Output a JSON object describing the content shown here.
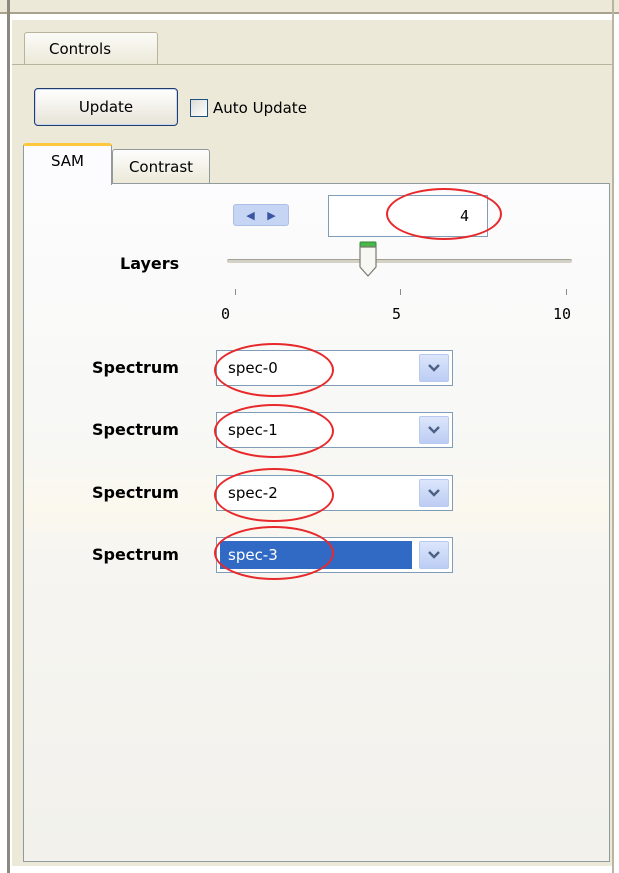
{
  "controls_tab": {
    "label": "Controls"
  },
  "toolbar": {
    "update_label": "Update",
    "auto_update_label": "Auto Update",
    "auto_update_checked": false
  },
  "subtabs": [
    {
      "label": "SAM",
      "active": true
    },
    {
      "label": "Contrast",
      "active": false
    }
  ],
  "layers": {
    "label": "Layers",
    "value": "4",
    "slider_value": 4,
    "slider_min": 0,
    "slider_max": 10,
    "ticks": [
      "0",
      "5",
      "10"
    ]
  },
  "spectra": [
    {
      "label": "Spectrum",
      "value": "spec-0",
      "selected": false
    },
    {
      "label": "Spectrum",
      "value": "spec-1",
      "selected": false
    },
    {
      "label": "Spectrum",
      "value": "spec-2",
      "selected": false
    },
    {
      "label": "Spectrum",
      "value": "spec-3",
      "selected": true
    }
  ],
  "colors": {
    "annotation": "#e8292b",
    "selection": "#316ac5",
    "active_tab_accent": "#ffc83c"
  }
}
